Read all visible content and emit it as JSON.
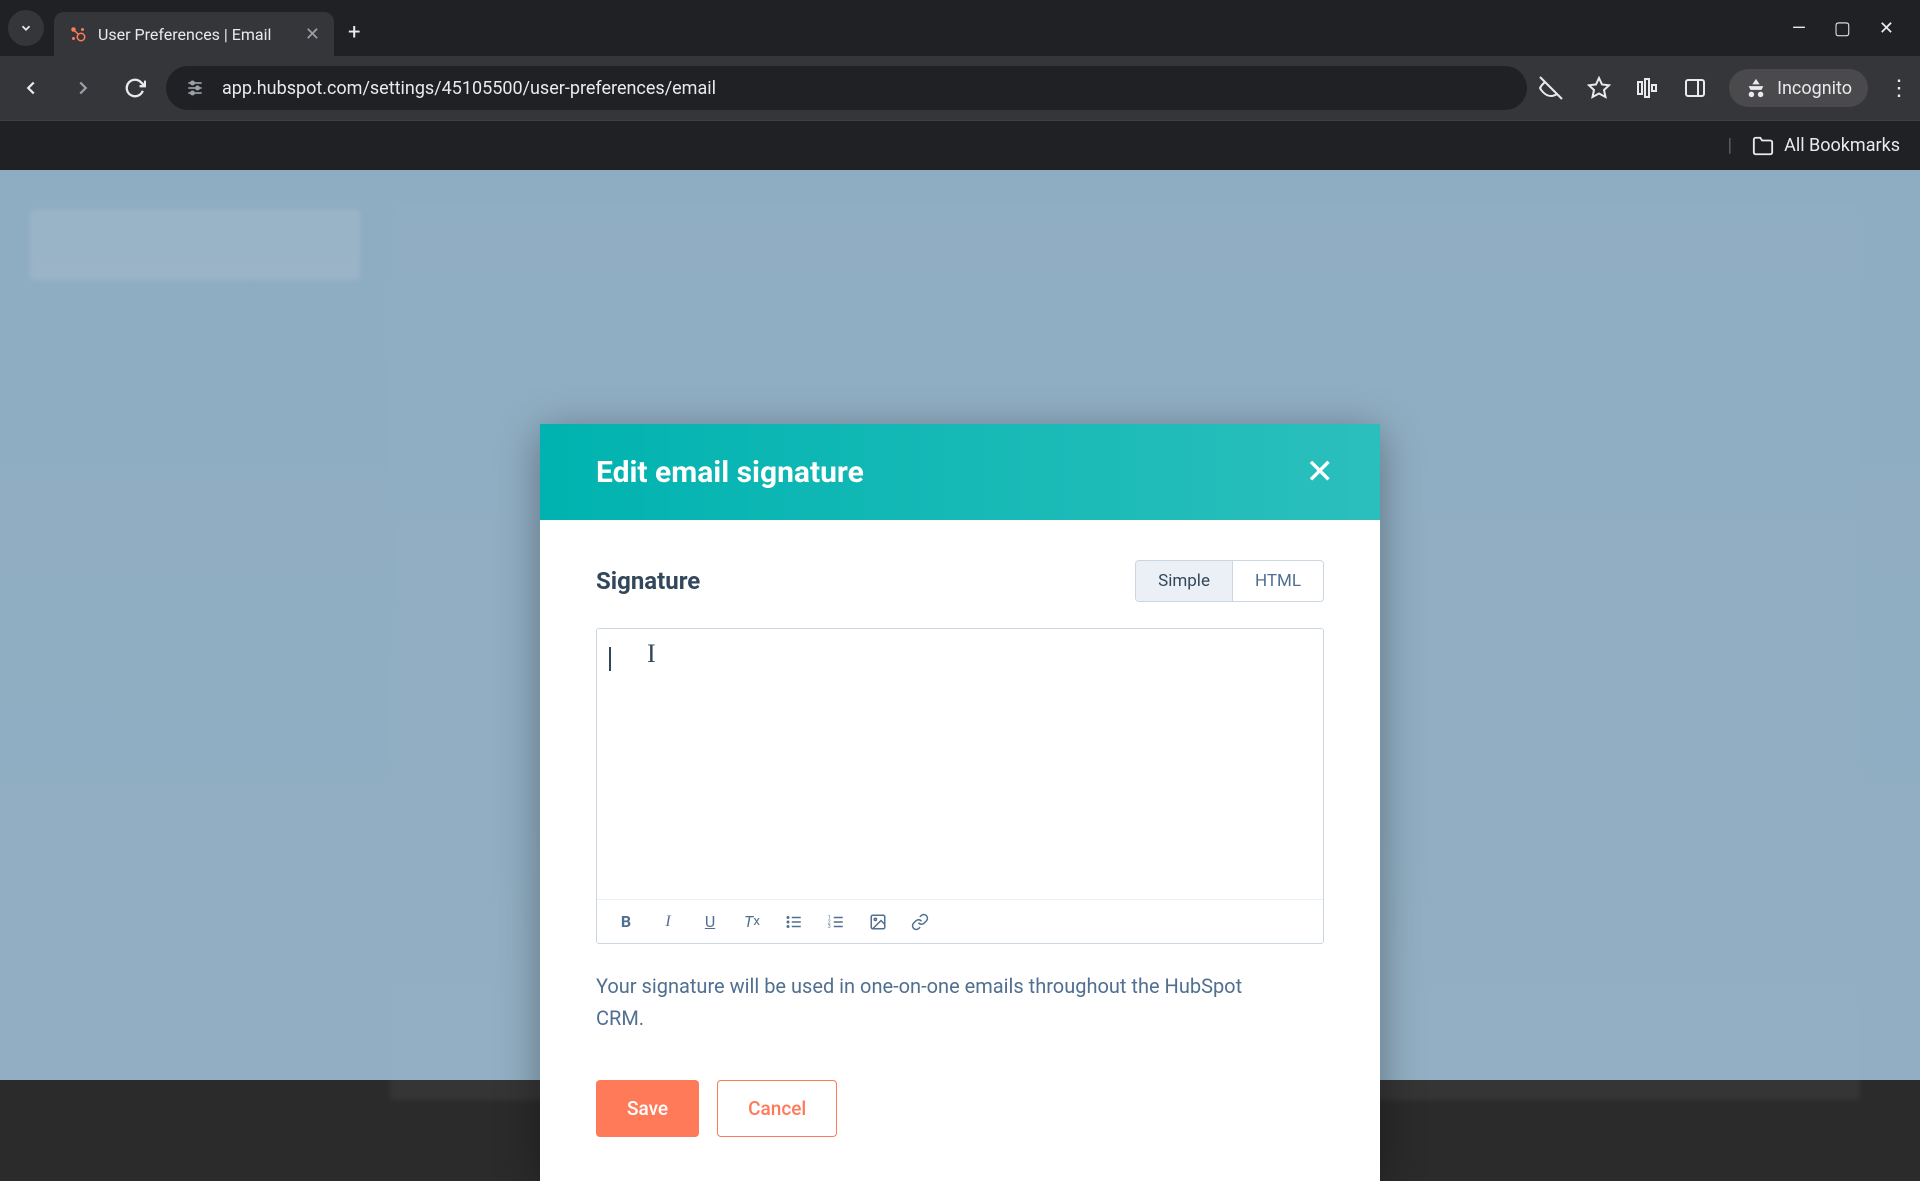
{
  "browser": {
    "tab_title": "User Preferences | Email",
    "url": "app.hubspot.com/settings/45105500/user-preferences/email",
    "incognito_label": "Incognito",
    "all_bookmarks": "All Bookmarks"
  },
  "modal": {
    "title": "Edit email signature",
    "signature_label": "Signature",
    "tabs": {
      "simple": "Simple",
      "html": "HTML"
    },
    "help_text": "Your signature will be used in one-on-one emails throughout the HubSpot CRM.",
    "save_label": "Save",
    "cancel_label": "Cancel",
    "editor_value": ""
  },
  "toolbar_icons": [
    "bold",
    "italic",
    "underline",
    "clear-format",
    "bullet-list",
    "numbered-list",
    "image",
    "link"
  ]
}
